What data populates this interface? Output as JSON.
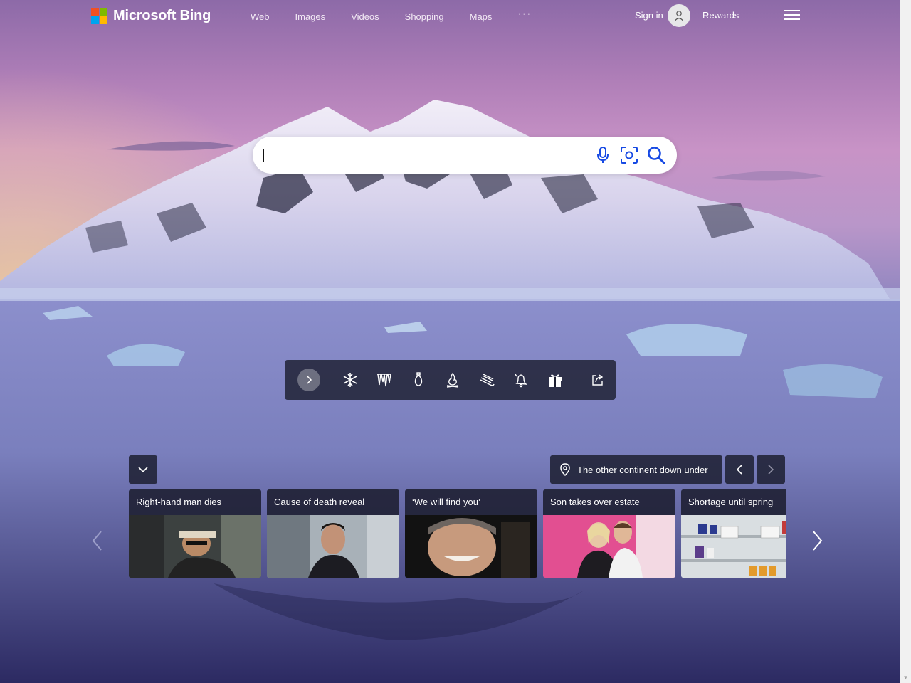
{
  "brand": {
    "name": "Microsoft Bing"
  },
  "nav": {
    "items": [
      "Web",
      "Images",
      "Videos",
      "Shopping",
      "Maps"
    ],
    "more": "···"
  },
  "account": {
    "signin_label": "Sign in",
    "rewards_label": "Rewards"
  },
  "search": {
    "value": "",
    "placeholder": ""
  },
  "toolbar": {
    "icons": [
      "snowflake-icon",
      "icicles-icon",
      "ornament-icon",
      "fireplace-icon",
      "sled-icon",
      "bell-icon",
      "gift-icon",
      "share-icon"
    ]
  },
  "location": {
    "label": "The other continent down under"
  },
  "news": [
    {
      "title": "Right-hand man dies"
    },
    {
      "title": "Cause of death reveal"
    },
    {
      "title": "‘We will find you’"
    },
    {
      "title": "Son takes over estate"
    },
    {
      "title": "Shortage until spring"
    }
  ],
  "colors": {
    "bar_bg": "#1c1e30",
    "logo_red": "#f25022",
    "logo_green": "#7fba00",
    "logo_blue": "#00a4ef",
    "logo_yellow": "#ffb900"
  }
}
